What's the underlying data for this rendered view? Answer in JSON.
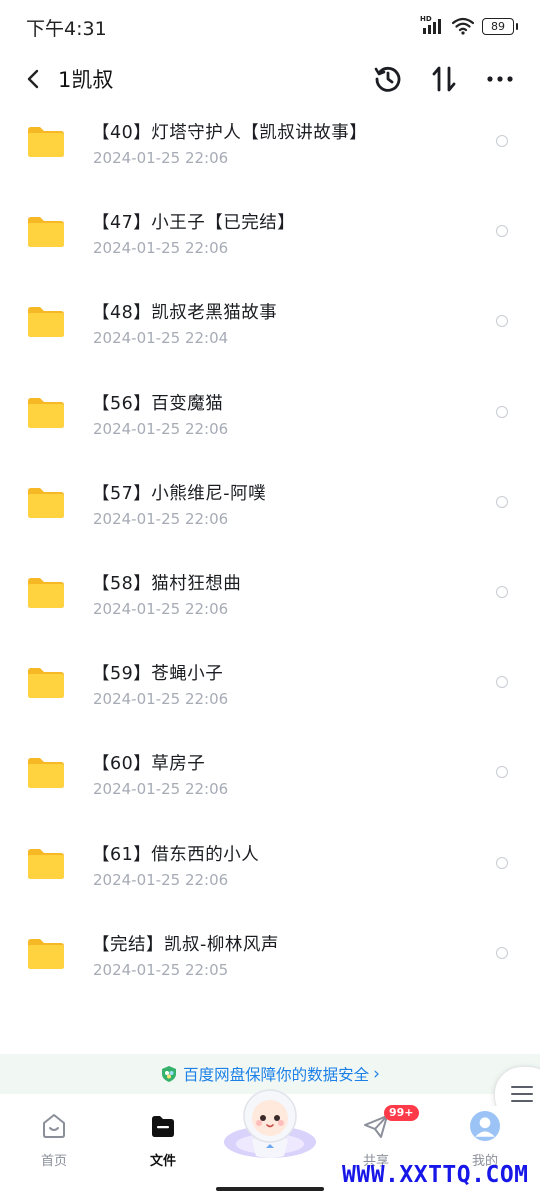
{
  "status_bar": {
    "time": "下午4:31",
    "battery": "89",
    "network_badge": "HD"
  },
  "header": {
    "title": "1凯叔",
    "icons": [
      "back-icon",
      "history-icon",
      "sort-icon",
      "more-icon"
    ]
  },
  "files": [
    {
      "name": "【40】灯塔守护人【凯叔讲故事】",
      "date": "2024-01-25  22:06"
    },
    {
      "name": "【47】小王子【已完结】",
      "date": "2024-01-25  22:06"
    },
    {
      "name": "【48】凯叔老黑猫故事",
      "date": "2024-01-25  22:04"
    },
    {
      "name": "【56】百变魔猫",
      "date": "2024-01-25  22:06"
    },
    {
      "name": "【57】小熊维尼-阿噗",
      "date": "2024-01-25  22:06"
    },
    {
      "name": "【58】猫村狂想曲",
      "date": "2024-01-25  22:06"
    },
    {
      "name": "【59】苍蝇小子",
      "date": "2024-01-25  22:06"
    },
    {
      "name": "【60】草房子",
      "date": "2024-01-25  22:06"
    },
    {
      "name": "【61】借东西的小人",
      "date": "2024-01-25  22:06"
    },
    {
      "name": "【完结】凯叔-柳林风声",
      "date": "2024-01-25  22:05"
    }
  ],
  "security_banner": {
    "text": "百度网盘保障你的数据安全",
    "arrow": "›"
  },
  "tabs": [
    {
      "label": "首页"
    },
    {
      "label": "文件",
      "active": true
    },
    {
      "label": "共享",
      "badge": "99+"
    },
    {
      "label": "我的"
    }
  ],
  "watermark": "WWW.XXTTQ.COM",
  "colors": {
    "accent": "#1d80e8",
    "folder": "#ffcc33",
    "badge": "#ff3b4a",
    "watermark": "#1717e8"
  }
}
